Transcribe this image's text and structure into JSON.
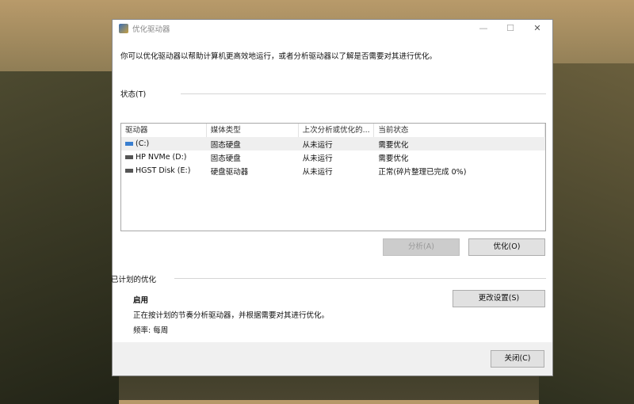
{
  "window": {
    "title": "优化驱动器",
    "minimize": "—",
    "maximize": "☐",
    "close": "✕"
  },
  "description": "你可以优化驱动器以帮助计算机更高效地运行，或者分析驱动器以了解是否需要对其进行优化。",
  "status": {
    "label": "状态(T)",
    "columns": [
      "驱动器",
      "媒体类型",
      "上次分析或优化的...",
      "当前状态"
    ],
    "rows": [
      {
        "drive": "(C:)",
        "media": "固态硬盘",
        "last": "从未运行",
        "state": "需要优化",
        "icon": "system-drive-icon",
        "selected": true
      },
      {
        "drive": "HP NVMe (D:)",
        "media": "固态硬盘",
        "last": "从未运行",
        "state": "需要优化",
        "icon": "drive-icon"
      },
      {
        "drive": "HGST Disk (E:)",
        "media": "硬盘驱动器",
        "last": "从未运行",
        "state": "正常(碎片整理已完成 0%)",
        "icon": "drive-icon"
      }
    ]
  },
  "buttons": {
    "analyze": "分析(A)",
    "optimize": "优化(O)",
    "change_settings": "更改设置(S)",
    "close": "关闭(C)"
  },
  "scheduled": {
    "label": "已计划的优化",
    "state": "启用",
    "desc": "正在按计划的节奏分析驱动器，并根据需要对其进行优化。",
    "frequency": "频率: 每周"
  }
}
